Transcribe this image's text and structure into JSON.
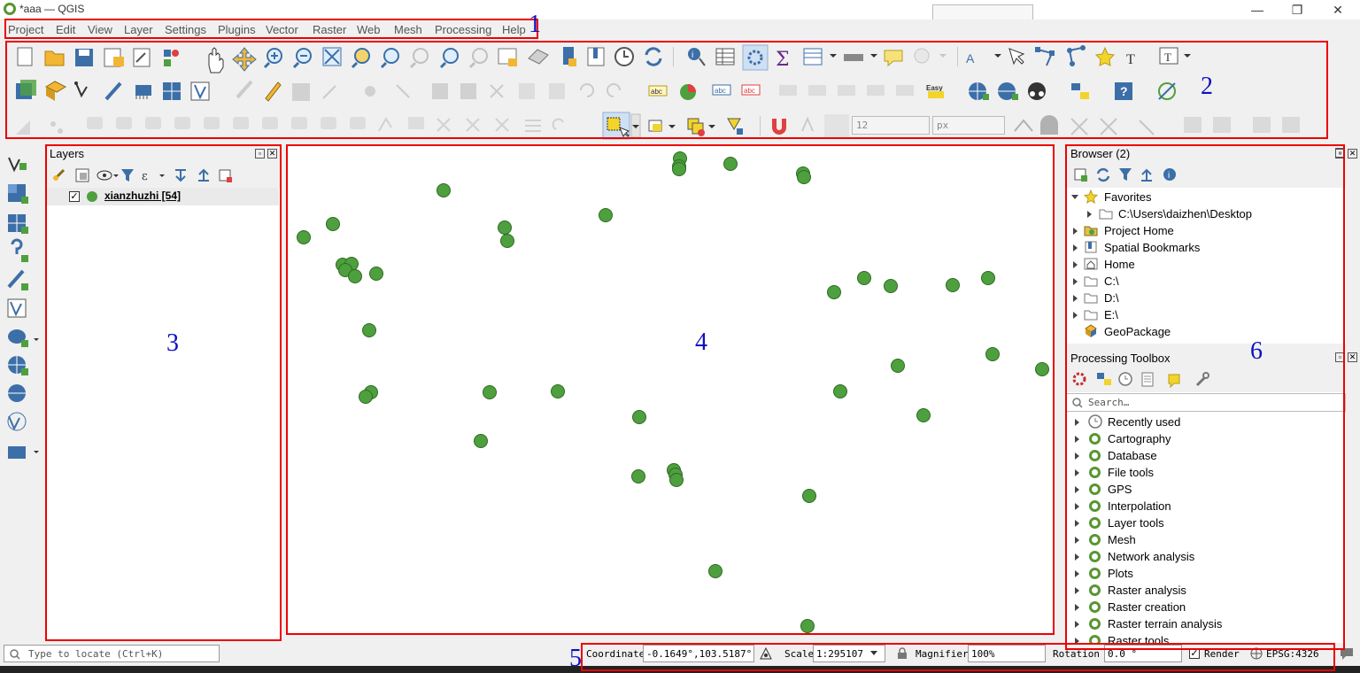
{
  "window": {
    "title": "*aaa — QGIS",
    "minimize": "—",
    "restore": "❐",
    "close": "✕"
  },
  "menu": [
    "Project",
    "Edit",
    "View",
    "Layer",
    "Settings",
    "Plugins",
    "Vector",
    "Raster",
    "Web",
    "Mesh",
    "Processing",
    "Help"
  ],
  "annotations": {
    "a1": "1",
    "a2": "2",
    "a3": "3",
    "a4": "4",
    "a5": "5",
    "a6": "6"
  },
  "toolbar": {
    "font_size_value": "12",
    "font_unit_value": "px"
  },
  "layers_panel": {
    "title": "Layers",
    "layer": {
      "name": "xianzhuzhi [54]",
      "checked": true,
      "color": "#4ea03e"
    }
  },
  "map": {
    "point_color": "#4ea03e",
    "point_stroke": "#2f6b24"
  },
  "browser_panel": {
    "title": "Browser (2)",
    "items": [
      {
        "label": "Favorites",
        "icon": "star-icon"
      },
      {
        "label": "C:\\Users\\daizhen\\Desktop",
        "icon": "folder-icon"
      },
      {
        "label": "Project Home",
        "icon": "project-home-icon"
      },
      {
        "label": "Spatial Bookmarks",
        "icon": "bookmark-icon"
      },
      {
        "label": "Home",
        "icon": "home-icon"
      },
      {
        "label": "C:\\",
        "icon": "folder-icon"
      },
      {
        "label": "D:\\",
        "icon": "folder-icon"
      },
      {
        "label": "E:\\",
        "icon": "folder-icon"
      },
      {
        "label": "GeoPackage",
        "icon": "geopackage-icon"
      }
    ]
  },
  "processing_toolbox": {
    "title": "Processing Toolbox",
    "search_placeholder": "Search…",
    "items": [
      "Recently used",
      "Cartography",
      "Database",
      "File tools",
      "GPS",
      "Interpolation",
      "Layer tools",
      "Mesh",
      "Network analysis",
      "Plots",
      "Raster analysis",
      "Raster creation",
      "Raster terrain analysis",
      "Raster tools"
    ]
  },
  "statusbar": {
    "locate_placeholder": "Type to locate (Ctrl+K)",
    "coordinate_label": "Coordinate",
    "coordinate_value": "-0.1649°,103.5187°",
    "scale_label": "Scale",
    "scale_value": "1:295107",
    "magnifier_label": "Magnifier",
    "magnifier_value": "100%",
    "rotation_label": "Rotation",
    "rotation_value": "0.0 °",
    "render_label": "Render",
    "render_checked": true,
    "crs_value": "EPSG:4326"
  }
}
